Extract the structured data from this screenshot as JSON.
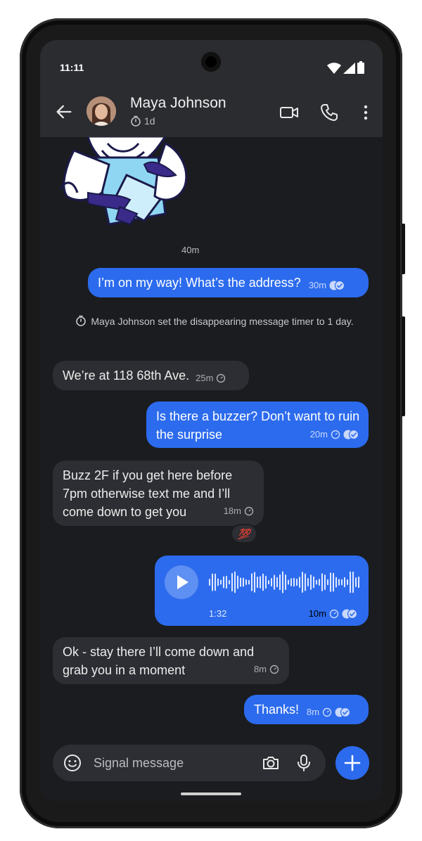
{
  "status_bar": {
    "time": "11:11"
  },
  "header": {
    "contact_name": "Maya Johnson",
    "timer_label": "1d",
    "icons": [
      "back-arrow-icon",
      "video-call-icon",
      "phone-call-icon",
      "more-options-icon"
    ]
  },
  "conversation": {
    "sticker_time": "40m",
    "system_message": "Maya Johnson set the disappearing message timer to 1 day.",
    "messages": [
      {
        "direction": "out",
        "text": "I’m on my way! What’s the address?",
        "time": "30m",
        "timer": false,
        "read": true
      },
      {
        "direction": "in",
        "text": "We’re at 118 68th Ave.",
        "time": "25m",
        "timer": true
      },
      {
        "direction": "out",
        "text": "Is there a buzzer? Don’t want to ruin the surprise",
        "time": "20m",
        "timer": true,
        "read": true
      },
      {
        "direction": "in",
        "text": "Buzz 2F if you get here before 7pm otherwise text me and I’ll come down to get you",
        "time": "18m",
        "timer": true,
        "reaction": "💯"
      },
      {
        "direction": "in",
        "text": "Ok - stay there I’ll come down and grab you in a moment",
        "time": "8m",
        "timer": true
      },
      {
        "direction": "out",
        "text": "Thanks!",
        "time": "8m",
        "timer": true,
        "read": true
      }
    ],
    "voice_note": {
      "duration": "1:32",
      "time": "10m",
      "timer": true,
      "read": true
    }
  },
  "composer": {
    "placeholder": "Signal message"
  },
  "colors": {
    "outgoing_bubble": "#2c6bed",
    "incoming_bubble": "#2d2e33",
    "background": "#1b1c1f",
    "header": "#2b2c30"
  }
}
